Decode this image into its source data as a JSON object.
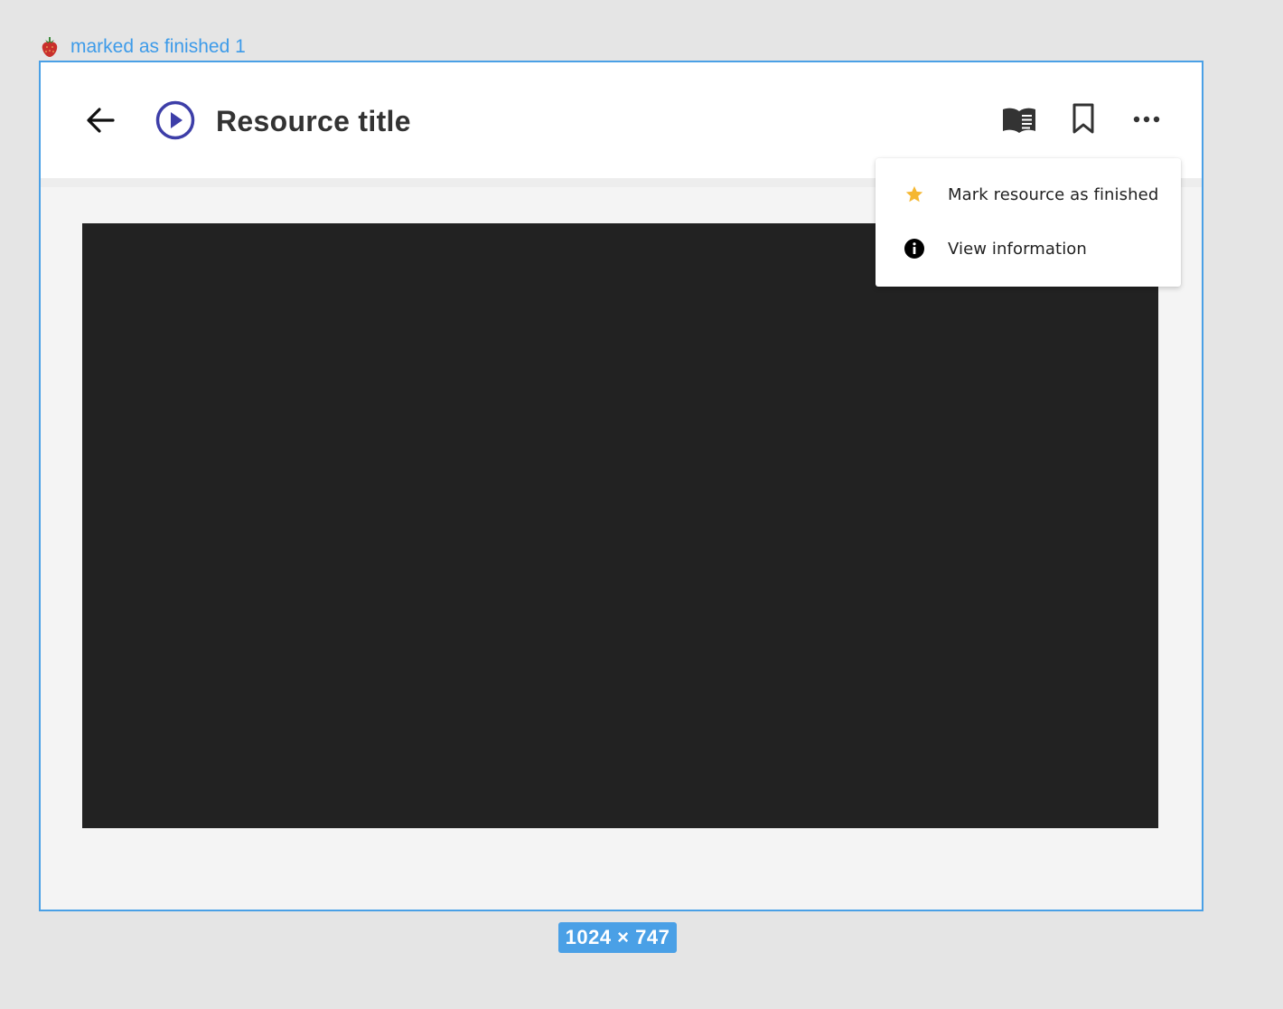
{
  "canvas": {
    "frame_label": "marked as finished 1",
    "size_badge": "1024 × 747",
    "accent_color": "#4aa0e6"
  },
  "header": {
    "title": "Resource title",
    "back_icon": "arrow-left-icon",
    "type_icon": "play-circle-icon",
    "actions": [
      {
        "name": "reader-mode",
        "icon": "book-reader-icon"
      },
      {
        "name": "bookmark",
        "icon": "bookmark-icon"
      },
      {
        "name": "more-options",
        "icon": "ellipsis-icon"
      }
    ]
  },
  "video": {
    "background_color": "#222222"
  },
  "menu": {
    "items": [
      {
        "label": "Mark resource as finished",
        "icon": "star-icon",
        "icon_color": "#f5b731"
      },
      {
        "label": "View information",
        "icon": "info-icon",
        "icon_color": "#000000"
      }
    ]
  }
}
